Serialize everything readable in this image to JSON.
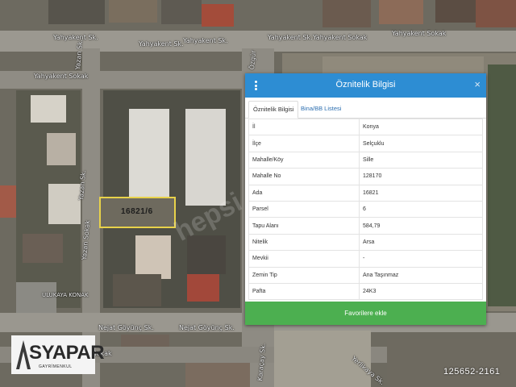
{
  "map": {
    "streets": [
      "Yahyakent Sk.",
      "Yahyakent Sk.",
      "Yahyakent Sk.",
      "Yahyakent Sk.",
      "Yahyakent Sokak",
      "Yahyakent Sokak",
      "Yahyakent Sokak",
      "Yazan Sk.",
      "Yazan Sk.",
      "Yazan Sokak",
      "Nejat Göyünç Sk.",
      "Nejat Göyünç Sk.",
      "Nejat Göyünç Sokak",
      "Yerlikaya Sk.",
      "Özgür",
      "Karaçay Sk."
    ],
    "poi_label": "ULUKAYA KONAK",
    "parcel_label": "16821/6",
    "watermark": "hepsi"
  },
  "panel": {
    "title": "Öznitelik Bilgisi",
    "close_symbol": "×",
    "tabs": [
      "Öznitelik Bilgisi",
      "Bina/BB Listesi"
    ],
    "rows": [
      {
        "key": "İl",
        "value": "Konya"
      },
      {
        "key": "İlçe",
        "value": "Selçuklu"
      },
      {
        "key": "Mahalle/Köy",
        "value": "Sille"
      },
      {
        "key": "Mahalle No",
        "value": "128170"
      },
      {
        "key": "Ada",
        "value": "16821"
      },
      {
        "key": "Parsel",
        "value": "6"
      },
      {
        "key": "Tapu Alanı",
        "value": "584,79"
      },
      {
        "key": "Nitelik",
        "value": "Arsa"
      },
      {
        "key": "Mevkii",
        "value": "-"
      },
      {
        "key": "Zemin Tip",
        "value": "Ana Taşınmaz"
      },
      {
        "key": "Pafta",
        "value": "24K3"
      }
    ],
    "favorite_button": "Favorilere ekle"
  },
  "logo": {
    "name": "SYAPAR",
    "subtitle": "GAYRİMENKUL"
  },
  "listing_id": "125652-2161",
  "colors": {
    "header": "#2d8dd3",
    "button": "#4caf50",
    "parcel_outline": "#e8d24a"
  }
}
